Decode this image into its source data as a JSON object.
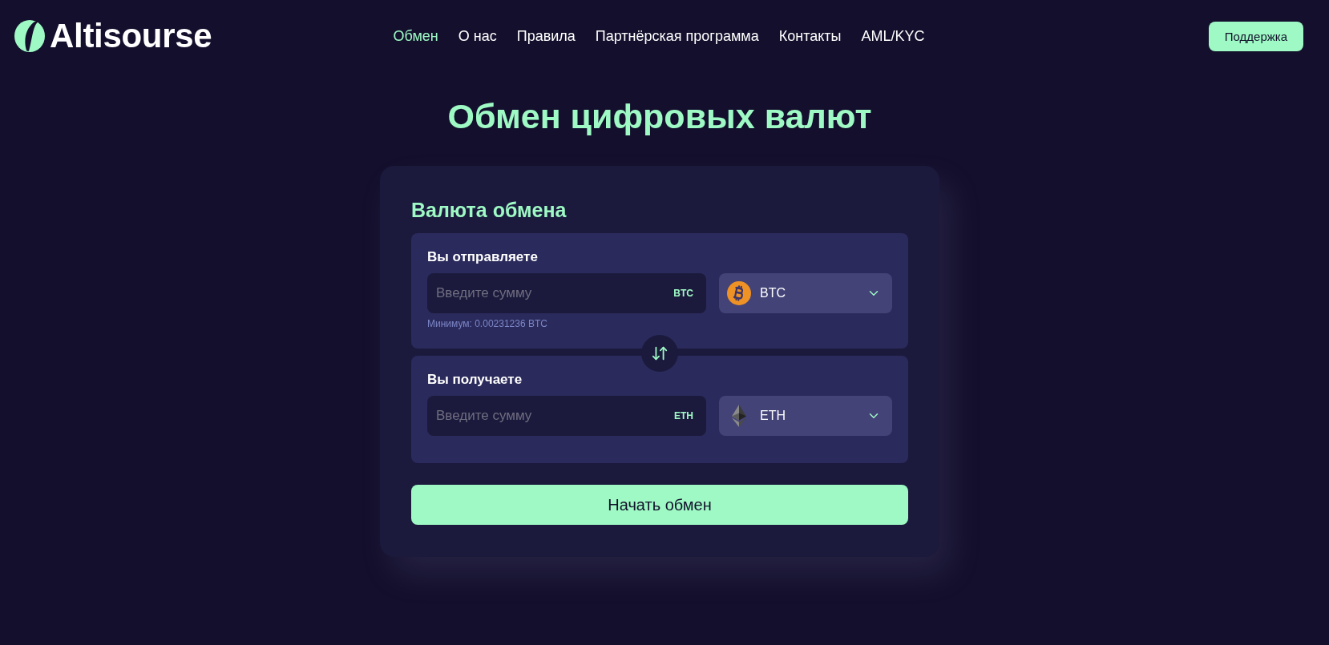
{
  "header": {
    "logo": {
      "text": "Altisourse"
    },
    "nav": [
      {
        "label": "Обмен",
        "selected": true
      },
      {
        "label": "О нас",
        "selected": false
      },
      {
        "label": "Правила",
        "selected": false
      },
      {
        "label": "Партнёрская программа",
        "selected": false
      },
      {
        "label": "Контакты",
        "selected": false
      },
      {
        "label": "AML/KYC",
        "selected": false
      }
    ],
    "support_button": "Поддержка"
  },
  "page_title": "Обмен цифровых валют",
  "exchange_card": {
    "title": "Валюта обмена",
    "sections": [
      {
        "label": "Вы отправляете",
        "amount": {
          "placeholder": "Введите сумму",
          "unit": "BTC"
        },
        "currency": {
          "name": "BTC",
          "kind": "btc"
        },
        "minimum": "Минимум: 0.00231236 BTC"
      },
      {
        "label": "Вы получаете",
        "amount": {
          "placeholder": "Введите сумму",
          "unit": "ETH"
        },
        "currency": {
          "name": "ETH",
          "kind": "eth"
        }
      }
    ],
    "submit_button": "Начать обмен"
  }
}
